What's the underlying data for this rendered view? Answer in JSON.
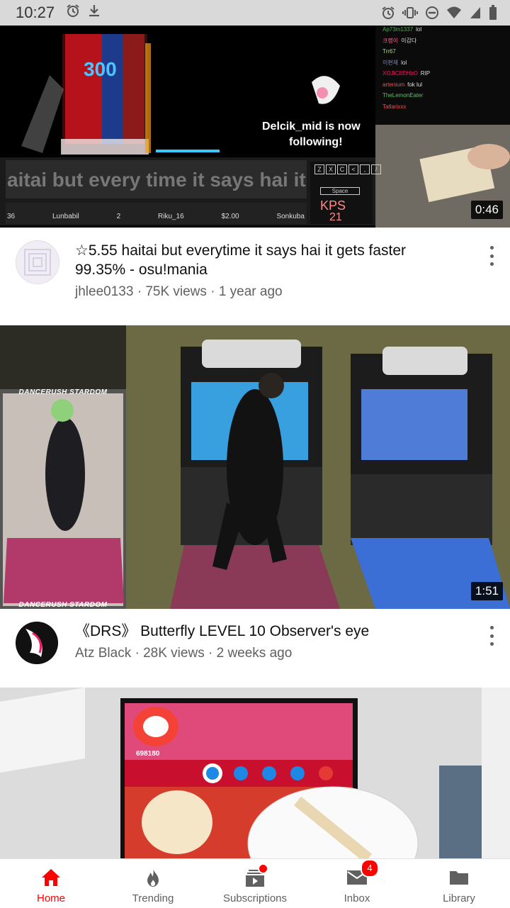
{
  "status_bar": {
    "time": "10:27"
  },
  "feed": [
    {
      "duration": "0:46",
      "title": "☆5.55 haitai but everytime it says hai it gets faster 99.35% - osu!mania",
      "channel": "jhlee0133",
      "views": "75K views",
      "age": "1 year ago",
      "separator": "·",
      "thumbnail_text": {
        "score": "300",
        "follow_line1": "Delcik_mid is now",
        "follow_line2": "following!",
        "banner": "aitai but every time it says hai it gets",
        "kps_label": "KPS",
        "kps_value": "21",
        "space_key": "Space",
        "keys": [
          "Z",
          "X",
          "C",
          "<",
          ",",
          "/"
        ],
        "players": [
          "36",
          "Lunbabil",
          "2",
          "Riku_16",
          "$2.00",
          "Sonkuba"
        ],
        "chat": [
          {
            "user": "Ap73m1337",
            "msg": "lol",
            "color": "#4caf50"
          },
          {
            "user": "크랭이",
            "msg": "이감다",
            "color": "#f06292"
          },
          {
            "user": "Trr67",
            "msg": "",
            "color": "#aed581"
          },
          {
            "user": "이편제",
            "msg": "lol",
            "color": "#7986cb"
          },
          {
            "user": "XOJICIIEHbO",
            "msg": "RIP",
            "color": "#e91e63"
          },
          {
            "user": "artenium",
            "msg": "fok lul",
            "color": "#ef5350"
          },
          {
            "user": "TheLemonEater",
            "msg": "",
            "color": "#66bb6a"
          },
          {
            "user": "Tatlarixxx",
            "msg": "",
            "color": "#ef5350"
          }
        ]
      }
    },
    {
      "duration": "1:51",
      "title": "《DRS》 Butterfly LEVEL 10 Observer's eye",
      "channel": "Atz Black",
      "views": "28K views",
      "age": "2 weeks ago",
      "separator": "·",
      "thumbnail_text": {
        "top_label": "DANCERUSH STARDOM",
        "bottom_label": "DANCERUSH STARDOM"
      }
    },
    {
      "thumbnail_text": {
        "score": "698180"
      }
    }
  ],
  "bottom_nav": [
    {
      "label": "Home",
      "icon": "home-icon",
      "active": true
    },
    {
      "label": "Trending",
      "icon": "flame-icon",
      "active": false
    },
    {
      "label": "Subscriptions",
      "icon": "subscriptions-icon",
      "active": false,
      "dot": true
    },
    {
      "label": "Inbox",
      "icon": "mail-icon",
      "active": false,
      "badge": "4"
    },
    {
      "label": "Library",
      "icon": "folder-icon",
      "active": false
    }
  ],
  "colors": {
    "accent": "#ff0000",
    "text_primary": "#0f0f0f",
    "text_secondary": "#606060"
  }
}
